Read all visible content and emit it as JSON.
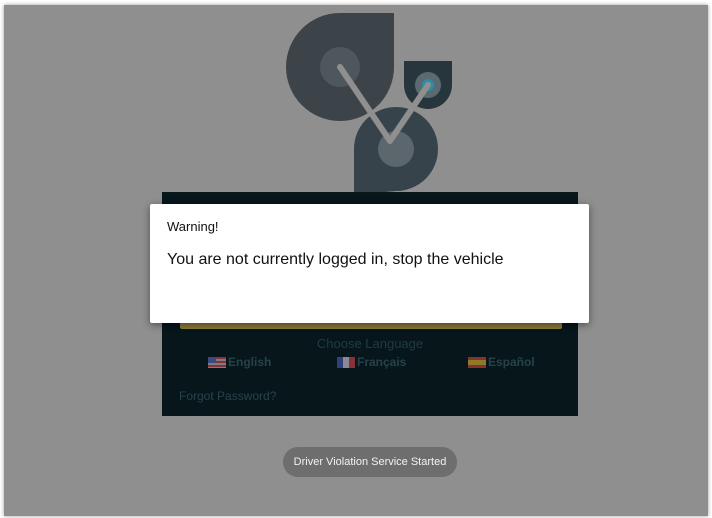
{
  "dialog": {
    "title": "Warning!",
    "message": "You are not currently logged in, stop the vehicle"
  },
  "login": {
    "choose_language": "Choose Language",
    "languages": [
      {
        "label": "English",
        "icon": "us-flag-icon"
      },
      {
        "label": "Français",
        "icon": "france-flag-icon"
      },
      {
        "label": "Español",
        "icon": "spain-flag-icon"
      }
    ],
    "forgot_password": "Forgot Password?"
  },
  "toast": {
    "text": "Driver Violation Service Started"
  },
  "colors": {
    "overlay": "#8f8f8f",
    "panel": "#06161a",
    "logo_dark": "#3f4a52",
    "logo_teal": "#2a8ea8",
    "dialog_bg": "#ffffff",
    "toast_bg": "#6e6e6e"
  }
}
